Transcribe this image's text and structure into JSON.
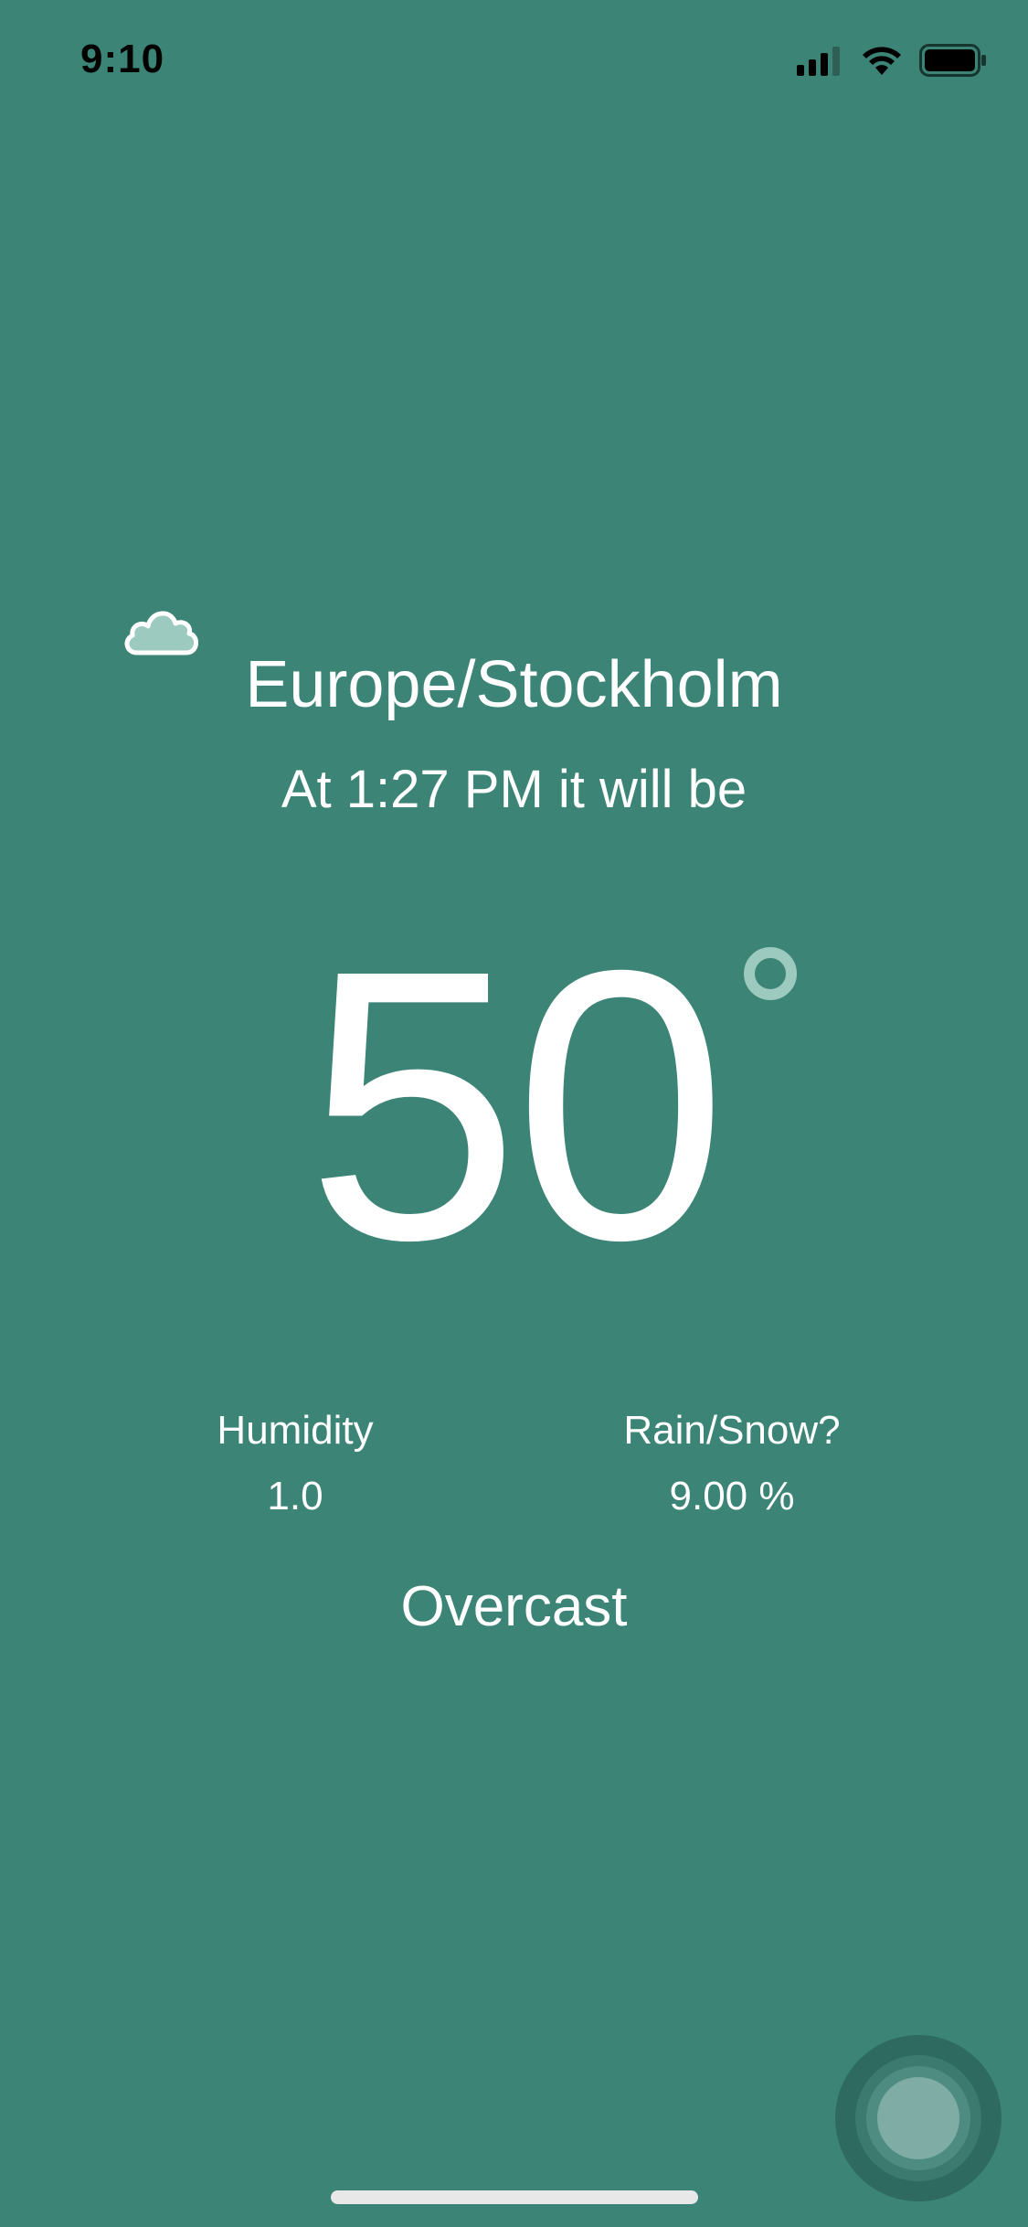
{
  "status_bar": {
    "time": "9:10",
    "icons": [
      "cellular-signal-icon",
      "wifi-icon",
      "battery-icon"
    ]
  },
  "weather": {
    "icon": "cloud-icon",
    "location": "Europe/Stockholm",
    "time_line": "At 1:27 PM it will be",
    "temperature": "50",
    "degree_icon": "degree-icon",
    "humidity_label": "Humidity",
    "humidity_value": "1.0",
    "precip_label": "Rain/Snow?",
    "precip_value": "9.00 %",
    "condition": "Overcast"
  },
  "colors": {
    "background": "#3b8476",
    "text": "#ffffff",
    "accent": "#9ccabf"
  }
}
